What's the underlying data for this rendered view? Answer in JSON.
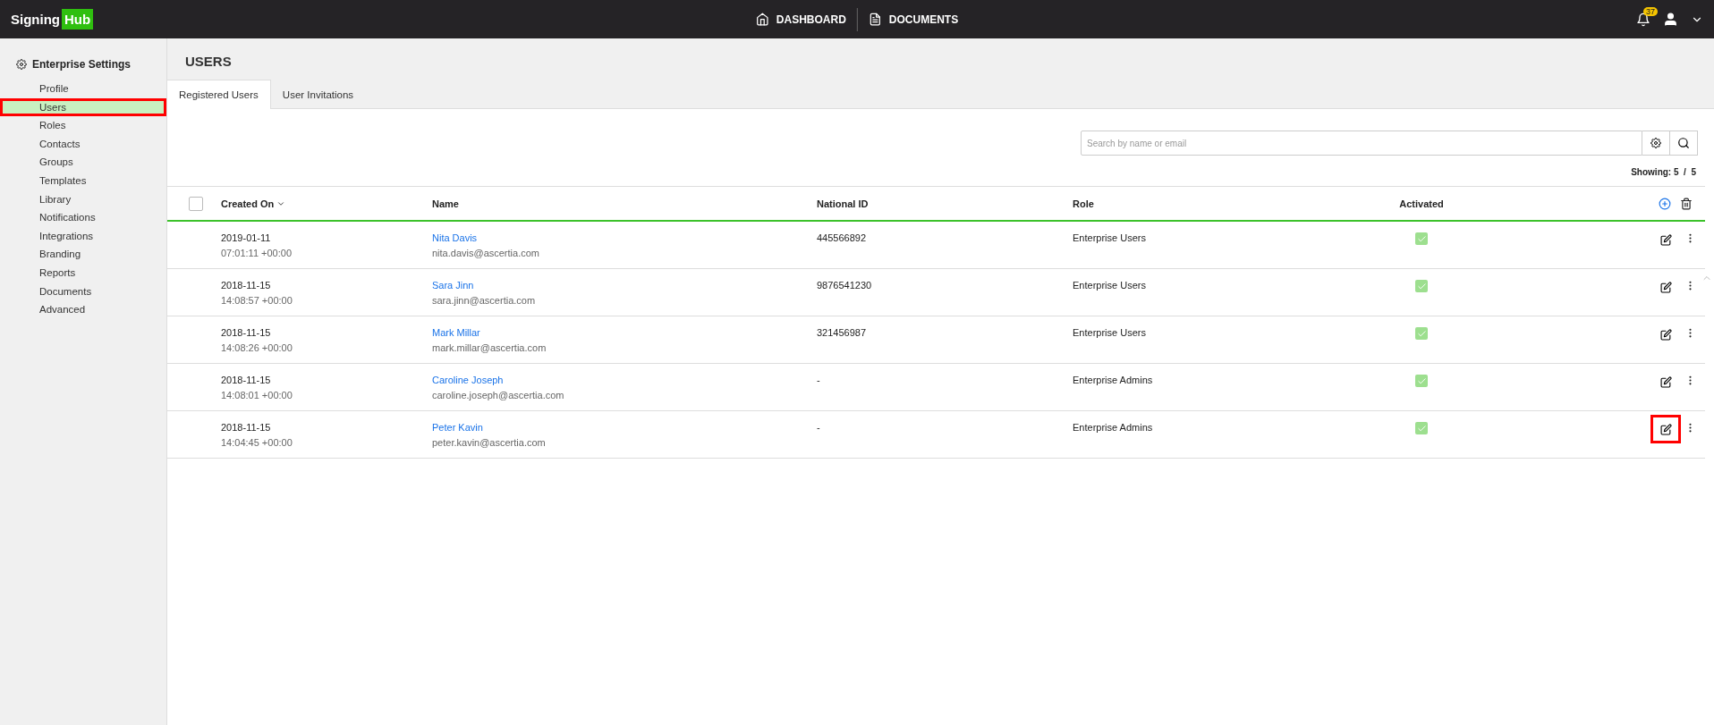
{
  "header": {
    "logo": {
      "part_1": "Signing",
      "part_2": "Hub"
    },
    "nav": [
      {
        "label": "DASHBOARD",
        "kind": "home"
      },
      {
        "label": "DOCUMENTS",
        "kind": "documents"
      }
    ],
    "notifications": "37"
  },
  "sidebar": {
    "title": "Enterprise Settings",
    "items": [
      {
        "label": "Profile",
        "selected": false,
        "highlighted": false
      },
      {
        "label": "Users",
        "selected": true,
        "highlighted": true
      },
      {
        "label": "Roles",
        "selected": false,
        "highlighted": false
      },
      {
        "label": "Contacts",
        "selected": false,
        "highlighted": false
      },
      {
        "label": "Groups",
        "selected": false,
        "highlighted": false
      },
      {
        "label": "Templates",
        "selected": false,
        "highlighted": false
      },
      {
        "label": "Library",
        "selected": false,
        "highlighted": false
      },
      {
        "label": "Notifications",
        "selected": false,
        "highlighted": false
      },
      {
        "label": "Integrations",
        "selected": false,
        "highlighted": false
      },
      {
        "label": "Branding",
        "selected": false,
        "highlighted": false
      },
      {
        "label": "Reports",
        "selected": false,
        "highlighted": false
      },
      {
        "label": "Documents",
        "selected": false,
        "highlighted": false
      },
      {
        "label": "Advanced",
        "selected": false,
        "highlighted": false
      }
    ]
  },
  "page_title": "USERS",
  "tabs": [
    {
      "label": "Registered Users",
      "selected": true
    },
    {
      "label": "User Invitations",
      "selected": false
    }
  ],
  "search": {
    "placeholder": "Search by name or email"
  },
  "showing": "Showing: 5  /  5",
  "table": {
    "select_all_checked": false,
    "columns": [
      "Created On",
      "Name",
      "National ID",
      "Role",
      "Activated"
    ],
    "rows": [
      {
        "date": "2019-01-11",
        "time": "07:01:11 +00:00",
        "name": "Nita Davis",
        "email": "nita.davis@ascertia.com",
        "national_id": "445566892",
        "role": "Enterprise Users",
        "activated": true,
        "edit_highlighted": false
      },
      {
        "date": "2018-11-15",
        "time": "14:08:57 +00:00",
        "name": "Sara Jinn",
        "email": "sara.jinn@ascertia.com",
        "national_id": "9876541230",
        "role": "Enterprise Users",
        "activated": true,
        "edit_highlighted": false
      },
      {
        "date": "2018-11-15",
        "time": "14:08:26 +00:00",
        "name": "Mark Millar",
        "email": "mark.millar@ascertia.com",
        "national_id": "321456987",
        "role": "Enterprise Users",
        "activated": true,
        "edit_highlighted": false
      },
      {
        "date": "2018-11-15",
        "time": "14:08:01 +00:00",
        "name": "Caroline Joseph",
        "email": "caroline.joseph@ascertia.com",
        "national_id": "-",
        "role": "Enterprise Admins",
        "activated": true,
        "edit_highlighted": false
      },
      {
        "date": "2018-11-15",
        "time": "14:04:45 +00:00",
        "name": "Peter Kavin",
        "email": "peter.kavin@ascertia.com",
        "national_id": "-",
        "role": "Enterprise Admins",
        "activated": true,
        "edit_highlighted": true
      }
    ]
  }
}
